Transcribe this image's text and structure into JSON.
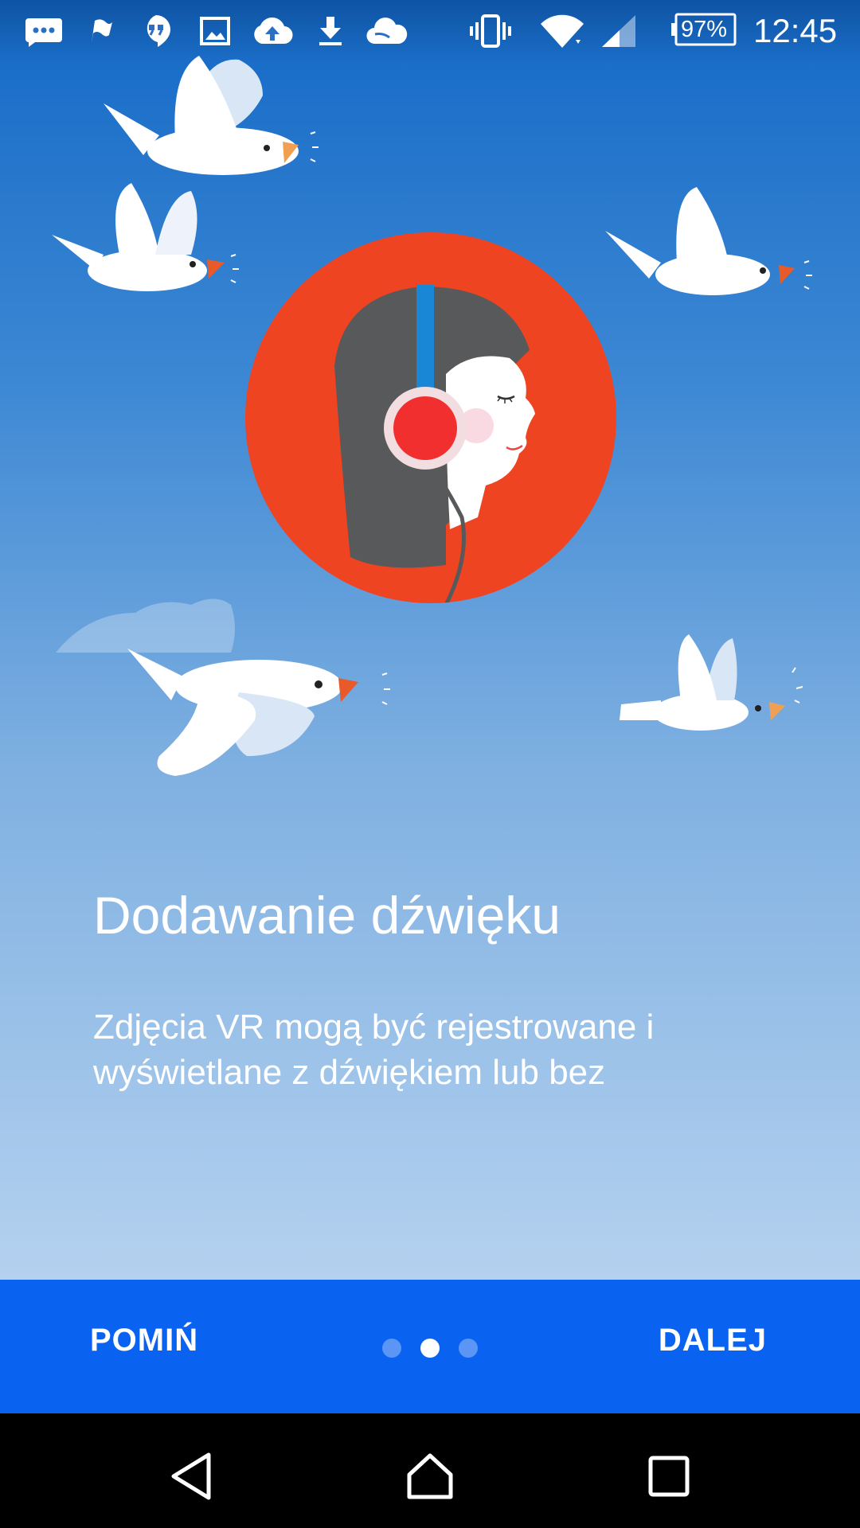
{
  "status_bar": {
    "battery": "97%",
    "time": "12:45",
    "icons": [
      "messaging-icon",
      "flag-icon",
      "hangouts-icon",
      "gallery-icon",
      "cloud-upload-icon",
      "download-icon",
      "cloud-icon",
      "vibrate-icon",
      "wifi-icon",
      "cellular-signal-icon",
      "battery-icon"
    ]
  },
  "onboarding": {
    "title": "Dodawanie dźwięku",
    "description": "Zdjęcia VR mogą być rejestrowane i wyświetlane z dźwiękiem lub bez"
  },
  "bottom_bar": {
    "skip_label": "POMIŃ",
    "next_label": "DALEJ",
    "page_count": 3,
    "current_page": 2
  },
  "navigation_bar": {
    "buttons": [
      "back-icon",
      "home-icon",
      "recents-icon"
    ]
  },
  "colors": {
    "bottom_bar": "#0a63f0",
    "sky_top": "#1469c6",
    "sky_bottom": "#b4d1ef",
    "circle": "#ee4422",
    "earcup": "#f22f2f",
    "headband": "#1a86d6"
  }
}
